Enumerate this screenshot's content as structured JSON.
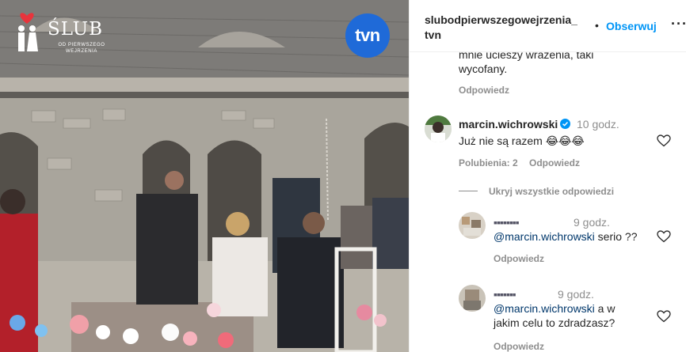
{
  "post": {
    "username": "slubodpierwszegowejrzenia_",
    "username_line2": "tvn",
    "separator": "•",
    "follow_label": "Obserwuj",
    "more_label": "···"
  },
  "media": {
    "show_logo_title": "ŚLUB",
    "show_logo_subtitle_1": "OD PIERWSZEGO",
    "show_logo_subtitle_2": "WEJRZENIA",
    "channel_logo": "tvn"
  },
  "comments": {
    "prev_comment_partial": "mnie ucieszy wrażenia, taki",
    "prev_comment_tail": "wycofany.",
    "prev_reply_label": "Odpowiedz",
    "main": {
      "username": "marcin.wichrowski",
      "verified_icon": "verified-badge-icon",
      "time": "10 godz.",
      "text": "Już nie są razem 😂😂😂",
      "likes": "Polubienia: 2",
      "reply_label": "Odpowiedz",
      "hide_replies_label": "Ukryj wszystkie odpowiedzi"
    },
    "replies": [
      {
        "username": "▪▪▪▪▪▪▪▪",
        "time": "9 godz.",
        "mention": "@marcin.wichrowski",
        "text": " serio ??",
        "reply_label": "Odpowiedz"
      },
      {
        "username": "▪▪▪▪▪▪▪",
        "time": "9 godz.",
        "mention": "@marcin.wichrowski",
        "text": " a w",
        "text_line2": "jakim celu to zdradzasz?",
        "reply_label": "Odpowiedz"
      }
    ]
  },
  "colors": {
    "link_blue": "#0095f6",
    "mention_blue": "#00376b",
    "meta_gray": "#8e8e8e",
    "tvn_blue": "#1f6ad8"
  }
}
